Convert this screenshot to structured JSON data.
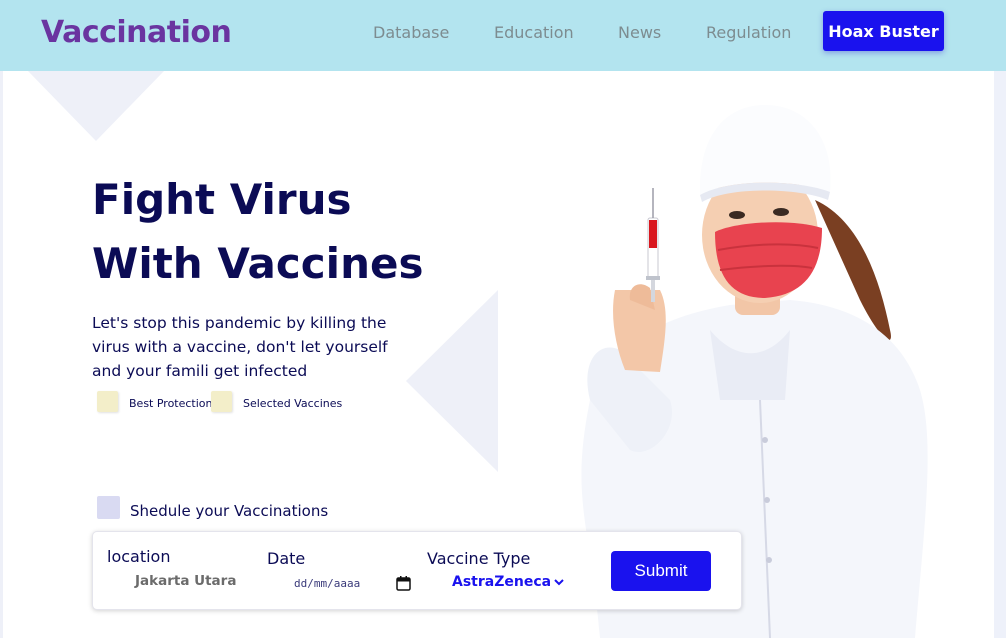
{
  "navbar": {
    "brand": "Vaccination",
    "links": [
      {
        "label": "Database"
      },
      {
        "label": "Education"
      },
      {
        "label": "News"
      },
      {
        "label": "Regulation"
      }
    ],
    "cta_label": "Hoax Buster"
  },
  "hero": {
    "title_line1": "Fight Virus",
    "title_line2": "With Vaccines",
    "description": "Let's stop this pandemic by killing the virus with a vaccine, don't let yourself and your famili get infected",
    "features": [
      {
        "label": "Best Protection"
      },
      {
        "label": "Selected Vaccines"
      }
    ],
    "schedule_label": "Shedule your Vaccinations"
  },
  "form": {
    "location_label": "location",
    "location_value": "Jakarta Utara",
    "date_label": "Date",
    "date_placeholder": "dd/mm/aaaa",
    "vaccine_label": "Vaccine Type",
    "vaccine_value": "AstraZeneca",
    "submit_label": "Submit"
  },
  "colors": {
    "navbar_bg": "#b3e4ef",
    "brand": "#6a34a0",
    "primary": "#1a12ee",
    "heading": "#0b0b55",
    "nav_link": "#7d8c90"
  },
  "icons": {
    "date": "calendar-icon",
    "select": "chevron-down-icon"
  }
}
